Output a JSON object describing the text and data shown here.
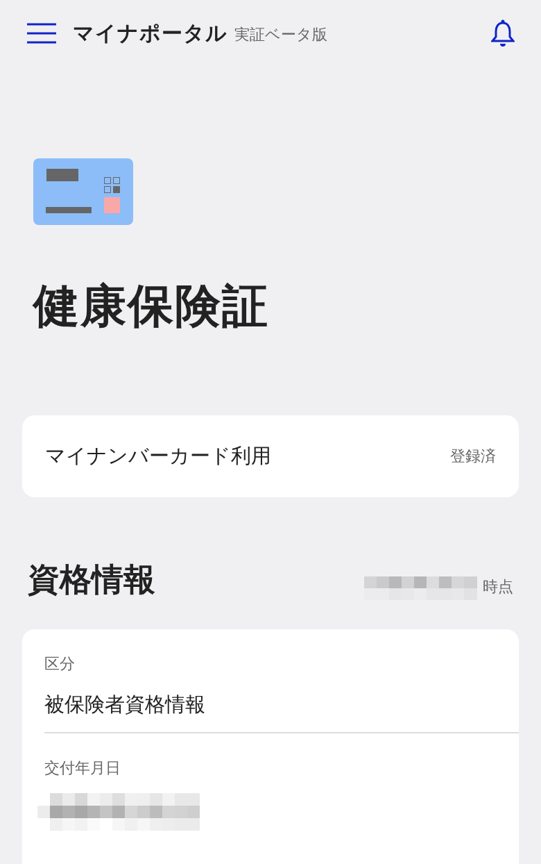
{
  "header": {
    "title": "マイナポータル",
    "subtitle": "実証ベータ版"
  },
  "page_title": "健康保険証",
  "card_usage": {
    "label": "マイナンバーカード利用",
    "status": "登録済"
  },
  "section": {
    "title": "資格情報",
    "as_of_suffix": "時点"
  },
  "fields": [
    {
      "label": "区分",
      "value": "被保険者資格情報"
    },
    {
      "label": "交付年月日"
    }
  ]
}
